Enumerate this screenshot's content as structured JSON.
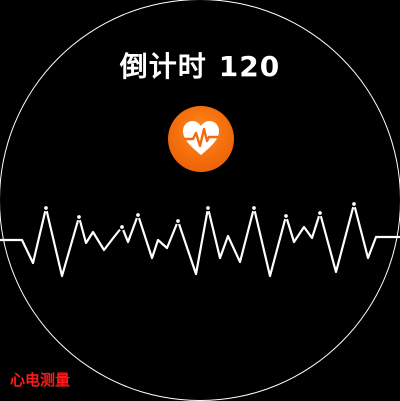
{
  "countdown": {
    "prefix": "倒计时",
    "seconds": "120"
  },
  "measure_button": {
    "icon": "heart-ecg-icon",
    "color": "#f26a0b"
  },
  "ecg": {
    "line_color": "#ffffff"
  },
  "mode_label": "心电测量",
  "colors": {
    "background": "#000000",
    "accent": "#f26a0b",
    "label": "#ff1a1a"
  }
}
